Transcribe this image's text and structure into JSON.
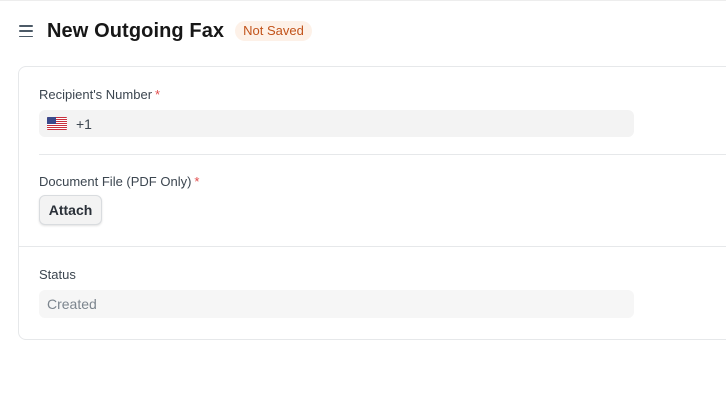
{
  "header": {
    "title": "New Outgoing Fax",
    "status_badge": "Not Saved"
  },
  "form": {
    "recipient": {
      "label": "Recipient's Number",
      "required_mark": "*",
      "country_flag": "us-flag-icon",
      "dial_code": "+1"
    },
    "document": {
      "label": "Document File (PDF Only)",
      "required_mark": "*",
      "attach_label": "Attach"
    },
    "status": {
      "label": "Status",
      "value": "Created"
    }
  },
  "colors": {
    "badge_bg": "#fdf1e8",
    "badge_text": "#c2531a",
    "required": "#e24c4c"
  }
}
